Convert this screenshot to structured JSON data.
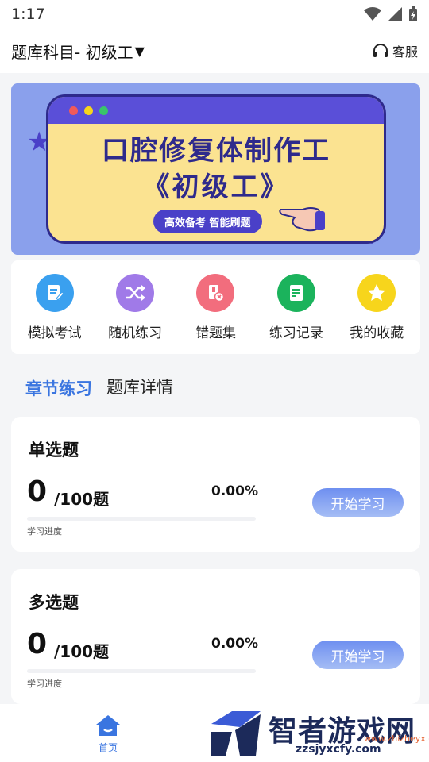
{
  "status_bar": {
    "time": "1:17"
  },
  "header": {
    "subject": "题库科目- 初级工",
    "caret": "▼",
    "service_label": "客服"
  },
  "banner": {
    "title_line1": "口腔修复体制作工",
    "title_line2": "《初级工》",
    "slogan": "高效备考 智能刷题"
  },
  "menu": {
    "items": [
      {
        "label": "模拟考试",
        "icon": "exam-icon",
        "color": "#3aa0ef"
      },
      {
        "label": "随机练习",
        "icon": "shuffle-icon",
        "color": "#a07ae8"
      },
      {
        "label": "错题集",
        "icon": "wrong-set-icon",
        "color": "#f26d7d"
      },
      {
        "label": "练习记录",
        "icon": "record-icon",
        "color": "#1bb35c"
      },
      {
        "label": "我的收藏",
        "icon": "star-icon",
        "color": "#f7d51c"
      }
    ]
  },
  "tabs": {
    "active": "章节练习",
    "other": "题库详情"
  },
  "question_cards": [
    {
      "title": "单选题",
      "done": "0",
      "total": "/100题",
      "percent": "0.00%",
      "progress": 0.0,
      "progress_label": "学习进度",
      "button": "开始学习"
    },
    {
      "title": "多选题",
      "done": "0",
      "total": "/100题",
      "percent": "0.00%",
      "progress": 0.0,
      "progress_label": "学习进度",
      "button": "开始学习"
    }
  ],
  "bottom_nav": {
    "home_label": "首页"
  },
  "watermark": {
    "title": "智者游戏网",
    "subtitle": "zzsjyxcfy.com",
    "tag": "www.zhizheyx.com"
  },
  "colors": {
    "accent": "#3a75e0",
    "banner_bg": "#8aa0ec",
    "banner_card": "#fbe391"
  }
}
